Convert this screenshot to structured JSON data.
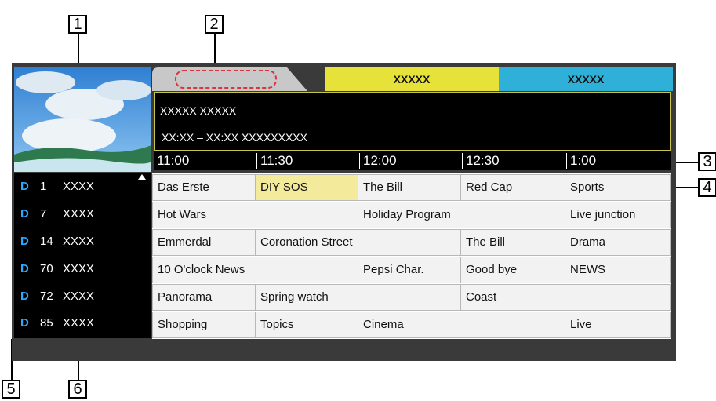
{
  "callouts": [
    "1",
    "2",
    "3",
    "4",
    "5",
    "6"
  ],
  "tabs": {
    "yellow_label": "XXXXX",
    "cyan_label": "XXXXX"
  },
  "info": {
    "line1": "XXXXX  XXXXX",
    "line2": "XX:XX – XX:XX  XXXXXXXXX"
  },
  "times": [
    "11:00",
    "11:30",
    "12:00",
    "12:30",
    "1:00"
  ],
  "channels": [
    {
      "type": "D",
      "num": "1",
      "name": "XXXX"
    },
    {
      "type": "D",
      "num": "7",
      "name": "XXXX"
    },
    {
      "type": "D",
      "num": "14",
      "name": "XXXX"
    },
    {
      "type": "D",
      "num": "70",
      "name": "XXXX"
    },
    {
      "type": "D",
      "num": "72",
      "name": "XXXX"
    },
    {
      "type": "D",
      "num": "85",
      "name": "XXXX"
    }
  ],
  "programs": [
    [
      "Das Erste",
      "DIY SOS",
      "The Bill",
      "Red Cap",
      "Sports"
    ],
    [
      "Hot Wars",
      "Holiday Program",
      "Live junction"
    ],
    [
      "Emmerdal",
      "Coronation Street",
      "The Bill",
      "Drama"
    ],
    [
      "10 O'clock News",
      "Pepsi Char.",
      "Good bye",
      "NEWS"
    ],
    [
      "Panorama",
      "Spring watch",
      "Coast"
    ],
    [
      "Shopping",
      "Topics",
      "Cinema",
      "Live"
    ]
  ],
  "colors": {
    "tab_yellow": "#e6e23a",
    "tab_cyan": "#2fb0d8",
    "selected": "#f3ea9c",
    "channel_d": "#2aa8ff"
  }
}
